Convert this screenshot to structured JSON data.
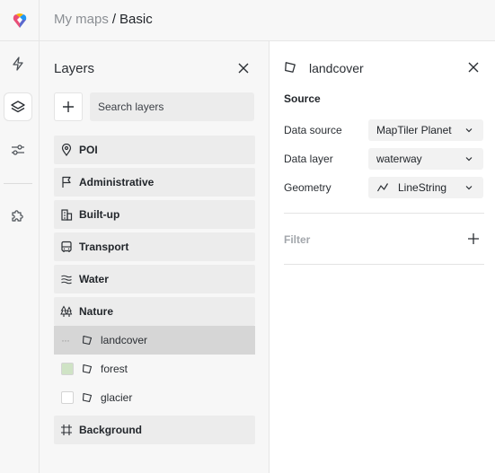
{
  "app": {
    "logo_icon": "maptiler-logo-icon",
    "brand_colors": [
      "#e94e77",
      "#f7b500",
      "#2196f3",
      "#8e44ad"
    ]
  },
  "breadcrumb": {
    "parent": "My maps",
    "separator": "/",
    "current": "Basic"
  },
  "rail": {
    "items": [
      {
        "name": "lightning-icon",
        "active": false
      },
      {
        "name": "layers-icon",
        "active": true
      },
      {
        "name": "sliders-icon",
        "active": false
      },
      {
        "name": "puzzle-icon",
        "active": false
      }
    ]
  },
  "layers_panel": {
    "title": "Layers",
    "search_placeholder": "Search layers",
    "groups": [
      {
        "label": "POI",
        "icon": "map-pin-icon"
      },
      {
        "label": "Administrative",
        "icon": "flag-icon"
      },
      {
        "label": "Built-up",
        "icon": "building-icon"
      },
      {
        "label": "Transport",
        "icon": "bus-icon"
      },
      {
        "label": "Water",
        "icon": "waves-icon"
      },
      {
        "label": "Nature",
        "icon": "trees-icon"
      }
    ],
    "nature_layers": [
      {
        "label": "landcover",
        "selected": true,
        "swatch": null
      },
      {
        "label": "forest",
        "selected": false,
        "swatch": "#cfe3c5"
      },
      {
        "label": "glacier",
        "selected": false,
        "swatch": "#ffffff"
      }
    ],
    "background_group": {
      "label": "Background",
      "icon": "frame-icon"
    }
  },
  "properties": {
    "title": "landcover",
    "source_section": "Source",
    "fields": [
      {
        "label": "Data source",
        "value": "MapTiler Planet"
      },
      {
        "label": "Data layer",
        "value": "waterway"
      },
      {
        "label": "Geometry",
        "value": "LineString",
        "icon": "linestring-icon"
      }
    ],
    "filter_section": "Filter"
  }
}
